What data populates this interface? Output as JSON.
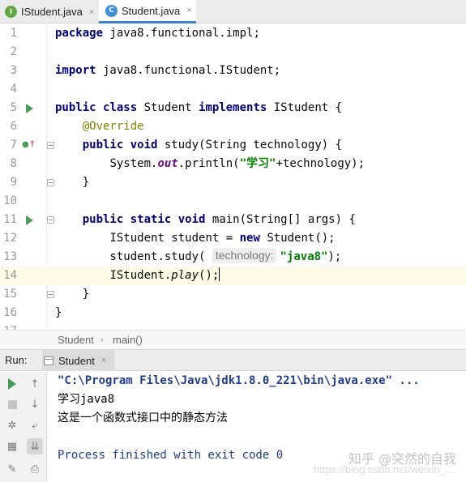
{
  "tabs": [
    {
      "label": "IStudent.java",
      "icon": "interface-icon",
      "active": false
    },
    {
      "label": "Student.java",
      "icon": "class-icon",
      "active": true
    }
  ],
  "tab_icon_letters": {
    "interface": "I",
    "class": "C"
  },
  "close_glyph": "×",
  "line_numbers": [
    "1",
    "2",
    "3",
    "4",
    "5",
    "6",
    "7",
    "8",
    "9",
    "10",
    "11",
    "12",
    "13",
    "14",
    "15",
    "16",
    "17"
  ],
  "code": {
    "l1_kw": "package",
    "l1_rest": " java8.functional.impl;",
    "l3_kw": "import",
    "l3_rest": " java8.functional.IStudent;",
    "l5_kw1": "public",
    "l5_kw2": "class",
    "l5_name": " Student ",
    "l5_kw3": "implements",
    "l5_rest": " IStudent {",
    "l6_anno": "@Override",
    "l7_kw1": "public",
    "l7_kw2": "void",
    "l7_rest": " study(String technology) {",
    "l8_pre": "System.",
    "l8_out": "out",
    "l8_mid": ".println(",
    "l8_str": "\"学习\"",
    "l8_rest": "+technology);",
    "l9": "}",
    "l11_kw1": "public",
    "l11_kw2": "static",
    "l11_kw3": "void",
    "l11_rest": " main(String[] args) {",
    "l12_pre": "IStudent student = ",
    "l12_kw": "new",
    "l12_rest": " Student();",
    "l13_pre": "student.study( ",
    "l13_hint": "technology:",
    "l13_str": "\"java8\"",
    "l13_rest": ");",
    "l14_pre": "IStudent.",
    "l14_method": "play",
    "l14_rest": "();",
    "l15": "}",
    "l16": "}"
  },
  "breadcrumbs": [
    "Student",
    "main()"
  ],
  "breadcrumb_sep": "›",
  "run_panel": {
    "label": "Run:",
    "tab_label": "Student"
  },
  "console": {
    "command": "\"C:\\Program Files\\Java\\jdk1.8.0_221\\bin\\java.exe\" ...",
    "output": [
      "学习java8",
      "这是一个函数式接口中的静态方法"
    ],
    "process": "Process finished with exit code 0"
  },
  "watermark": {
    "text": "知乎 @突然的自我",
    "url": "https://blog.csdn.net/weixin_..."
  },
  "colors": {
    "keyword": "#000080",
    "annotation": "#808000",
    "string": "#008000",
    "static_field": "#660e7a",
    "line_number": "#999999",
    "current_line": "#fdfae6",
    "console_command": "#1f3c88",
    "run_green": "#499c54",
    "tab_underline": "#4083c9"
  }
}
